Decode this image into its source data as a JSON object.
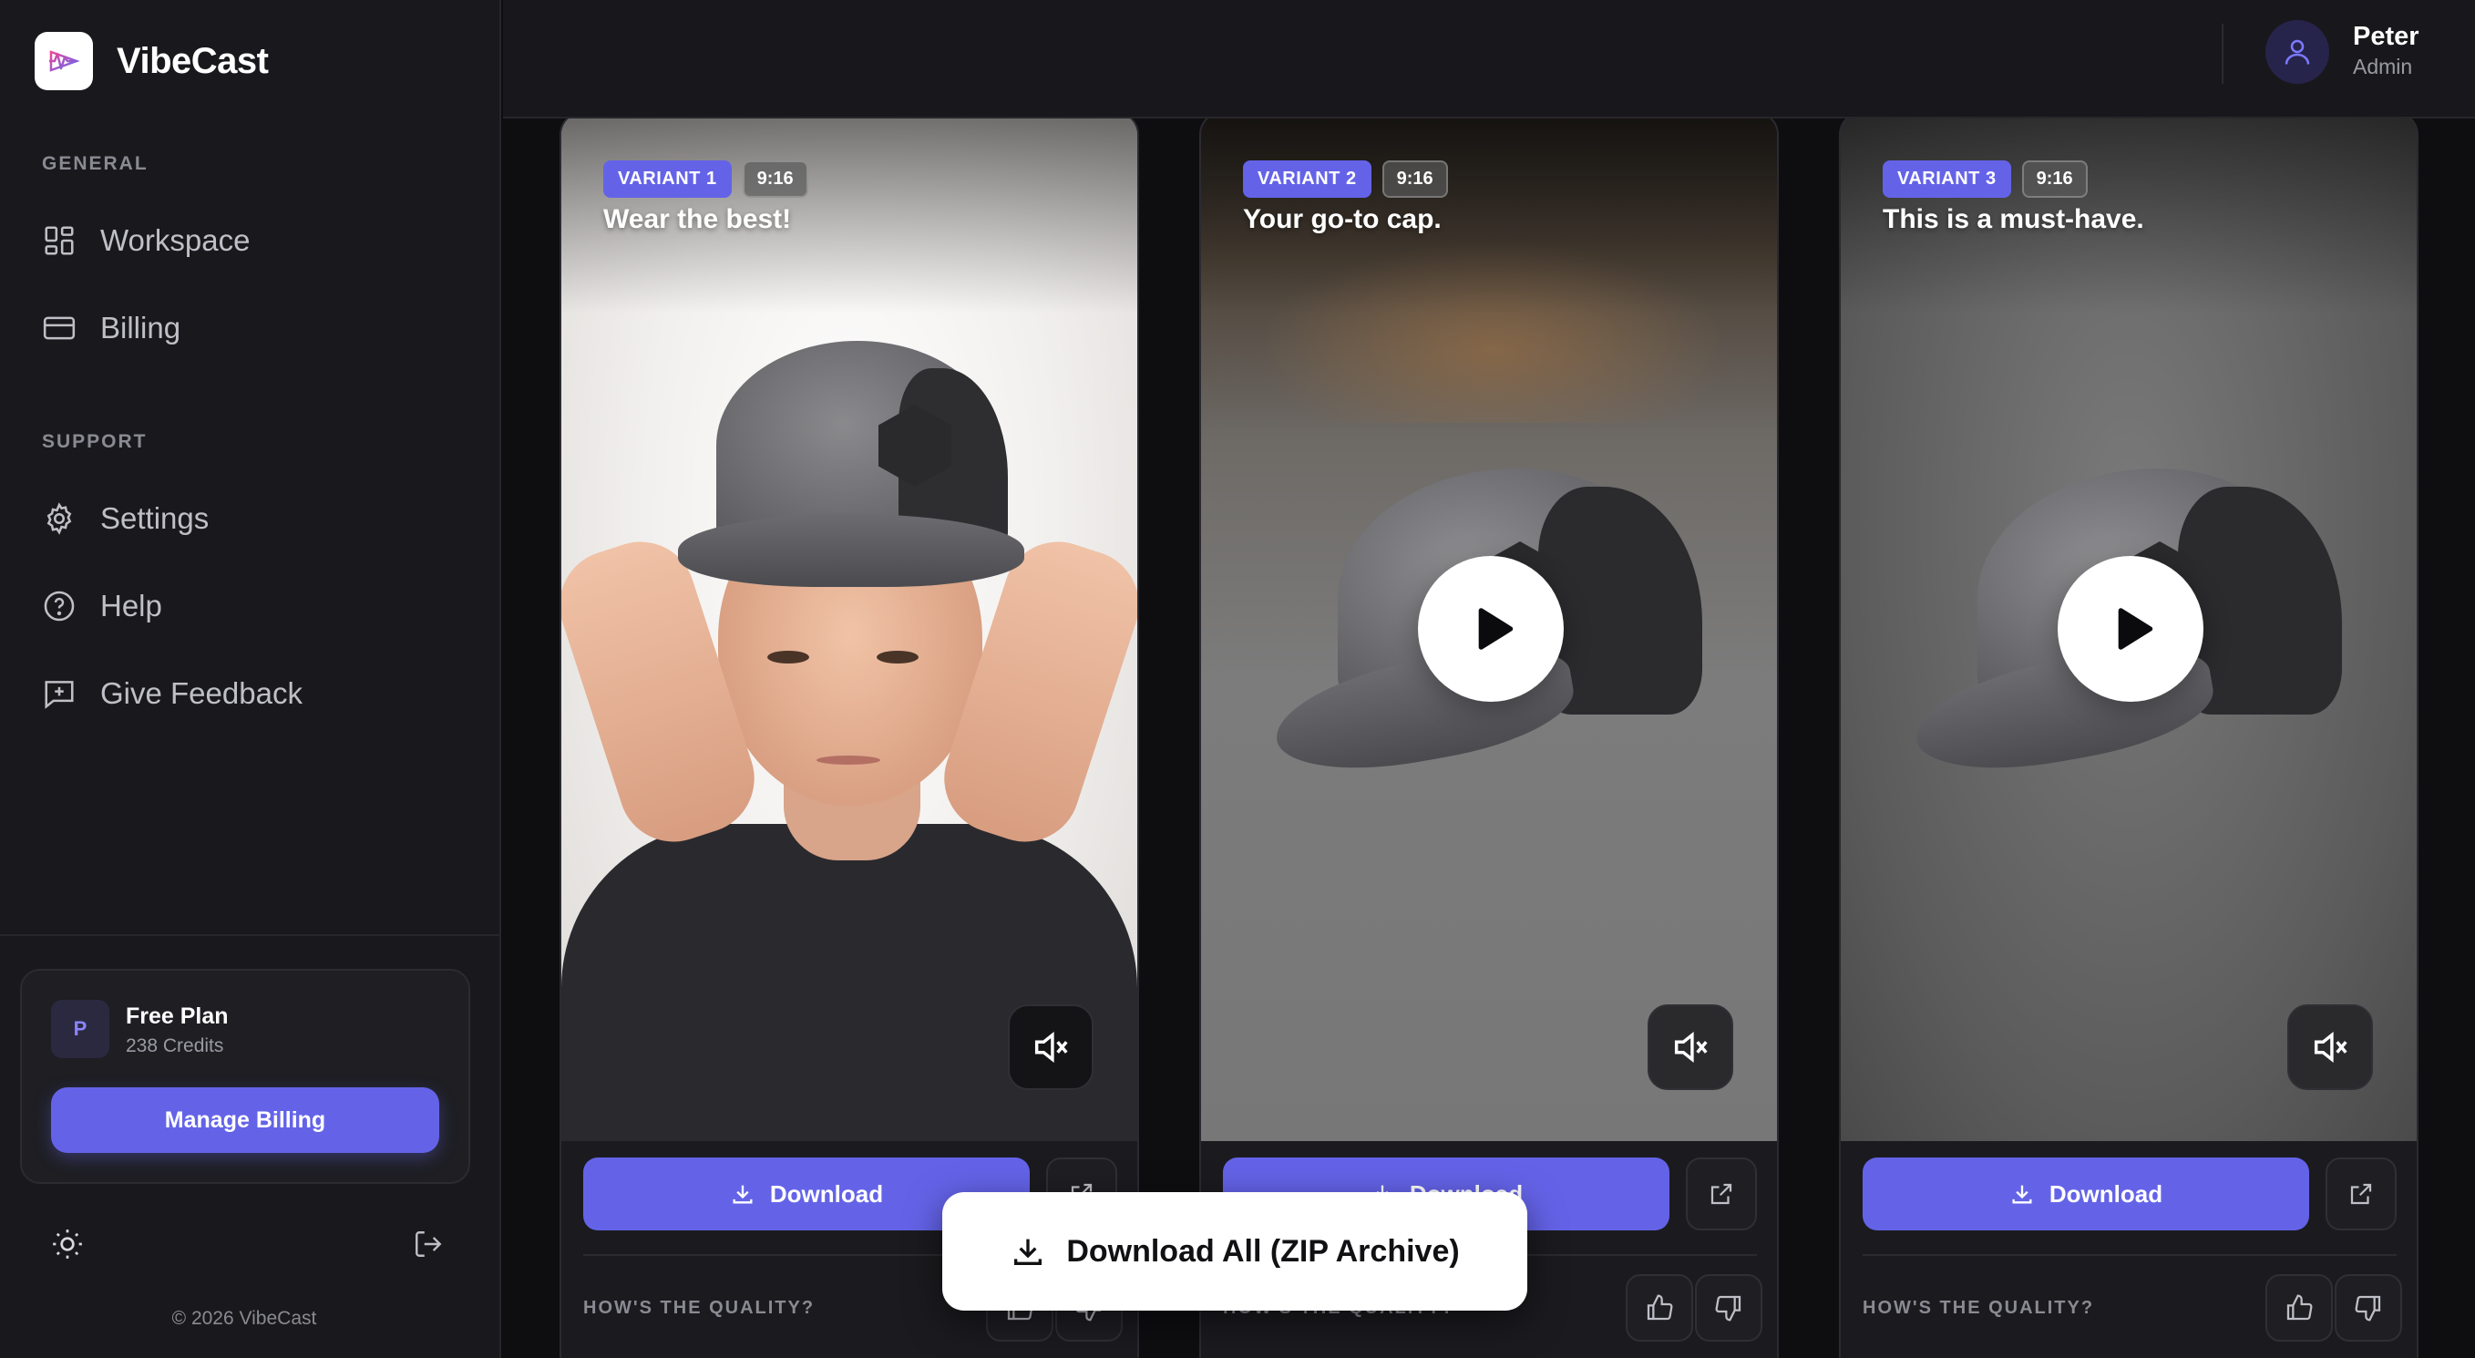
{
  "brand": {
    "name": "VibeCast"
  },
  "sidebar": {
    "sections": [
      {
        "label": "GENERAL",
        "items": [
          {
            "label": "Workspace",
            "icon": "grid-icon"
          },
          {
            "label": "Billing",
            "icon": "credit-card-icon"
          }
        ]
      },
      {
        "label": "SUPPORT",
        "items": [
          {
            "label": "Settings",
            "icon": "gear-icon"
          },
          {
            "label": "Help",
            "icon": "help-circle-icon"
          },
          {
            "label": "Give Feedback",
            "icon": "feedback-icon"
          }
        ]
      }
    ],
    "plan": {
      "avatar": "P",
      "name": "Free Plan",
      "credits": "238 Credits",
      "button": "Manage Billing"
    },
    "copyright": "© 2026 VibeCast"
  },
  "header": {
    "user": {
      "name": "Peter",
      "role": "Admin"
    }
  },
  "cards": [
    {
      "variant": "VARIANT 1",
      "ratio": "9:16",
      "caption": "Wear the best!",
      "download": "Download",
      "quality_label": "HOW'S THE QUALITY?",
      "playing": true
    },
    {
      "variant": "VARIANT 2",
      "ratio": "9:16",
      "caption": "Your go-to cap.",
      "download": "Download",
      "quality_label": "HOW'S THE QUALITY?",
      "playing": false
    },
    {
      "variant": "VARIANT 3",
      "ratio": "9:16",
      "caption": "This is a must-have.",
      "download": "Download",
      "quality_label": "HOW'S THE QUALITY?",
      "playing": false
    }
  ],
  "zip": {
    "label": "Download All (ZIP Archive)"
  },
  "colors": {
    "accent": "#6463e8",
    "sidebar_bg": "#19191d",
    "page_bg": "#0e0e11"
  }
}
